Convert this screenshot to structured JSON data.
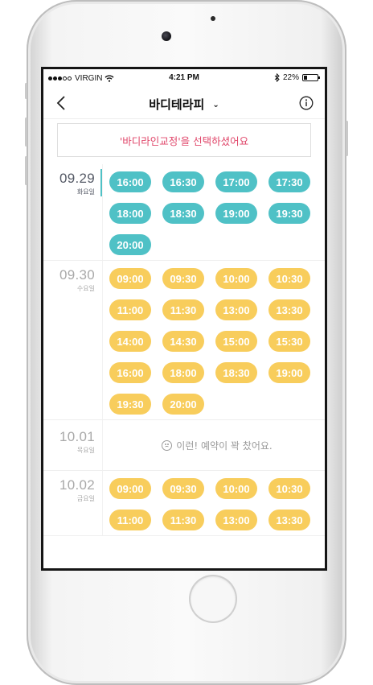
{
  "status_bar": {
    "carrier": "VIRGIN",
    "time": "4:21 PM",
    "battery": "22%",
    "battery_level": 0.22
  },
  "navbar": {
    "title": "바디테라피",
    "caret": "⌄"
  },
  "notice": "'바디라인교정'을 선택하셨어요",
  "colors": {
    "teal": "#4fc1c6",
    "yellow": "#f8cd5c",
    "notice_pink": "#e0466a"
  },
  "days": [
    {
      "date": "09.29",
      "dow": "화요일",
      "active": true,
      "color": "teal",
      "slots": [
        "16:00",
        "16:30",
        "17:00",
        "17:30",
        "18:00",
        "18:30",
        "19:00",
        "19:30",
        "20:00"
      ]
    },
    {
      "date": "09.30",
      "dow": "수요일",
      "active": false,
      "color": "yellow",
      "slots": [
        "09:00",
        "09:30",
        "10:00",
        "10:30",
        "11:00",
        "11:30",
        "13:00",
        "13:30",
        "14:00",
        "14:30",
        "15:00",
        "15:30",
        "16:00",
        "18:00",
        "18:30",
        "19:00",
        "19:30",
        "20:00"
      ]
    },
    {
      "date": "10.01",
      "dow": "목요일",
      "active": false,
      "color": "yellow",
      "slots": [],
      "empty_message": "이런! 예약이 꽉 찼어요."
    },
    {
      "date": "10.02",
      "dow": "금요일",
      "active": false,
      "color": "yellow",
      "slots": [
        "09:00",
        "09:30",
        "10:00",
        "10:30",
        "11:00",
        "11:30",
        "13:00",
        "13:30"
      ]
    }
  ]
}
